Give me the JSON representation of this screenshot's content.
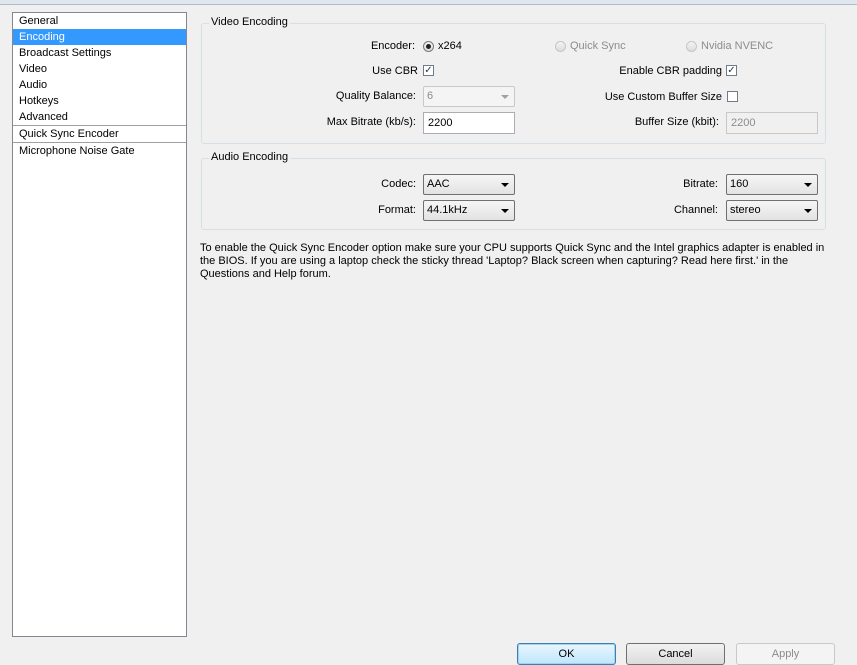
{
  "sidebar": {
    "items": [
      {
        "label": "General"
      },
      {
        "label": "Encoding"
      },
      {
        "label": "Broadcast Settings"
      },
      {
        "label": "Video"
      },
      {
        "label": "Audio"
      },
      {
        "label": "Hotkeys"
      },
      {
        "label": "Advanced"
      },
      {
        "label": "Quick Sync Encoder"
      },
      {
        "label": "Microphone Noise Gate"
      }
    ],
    "selected": "Encoding"
  },
  "video_encoding": {
    "title": "Video Encoding",
    "encoder_label": "Encoder:",
    "encoder_options": [
      {
        "label": "x264",
        "checked": true,
        "enabled": true
      },
      {
        "label": "Quick Sync",
        "checked": false,
        "enabled": false
      },
      {
        "label": "Nvidia NVENC",
        "checked": false,
        "enabled": false
      }
    ],
    "use_cbr_label": "Use CBR",
    "use_cbr_checked": true,
    "cbr_padding_label": "Enable CBR padding",
    "cbr_padding_checked": true,
    "quality_balance_label": "Quality Balance:",
    "quality_balance_value": "6",
    "custom_buffer_label": "Use Custom Buffer Size",
    "custom_buffer_checked": false,
    "max_bitrate_label": "Max Bitrate (kb/s):",
    "max_bitrate_value": "2200",
    "buffer_size_label": "Buffer Size (kbit):",
    "buffer_size_value": "2200"
  },
  "audio_encoding": {
    "title": "Audio Encoding",
    "codec_label": "Codec:",
    "codec_value": "AAC",
    "bitrate_label": "Bitrate:",
    "bitrate_value": "160",
    "format_label": "Format:",
    "format_value": "44.1kHz",
    "channel_label": "Channel:",
    "channel_value": "stereo"
  },
  "info_text": "To enable the Quick Sync Encoder option make sure your CPU supports Quick Sync and the Intel graphics adapter is enabled in the BIOS. If you are using a laptop check the sticky thread 'Laptop? Black screen when capturing? Read here first.' in the Questions and Help forum.",
  "buttons": {
    "ok": "OK",
    "cancel": "Cancel",
    "apply": "Apply"
  },
  "colors": {
    "selection": "#3399ff",
    "window_bg": "#f0f0f0"
  }
}
